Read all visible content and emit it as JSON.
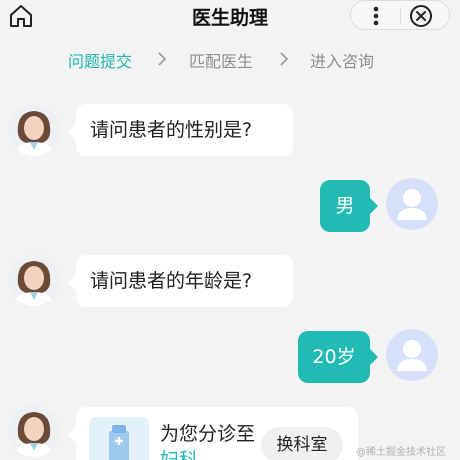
{
  "header": {
    "title": "医生助理",
    "icons": {
      "home": "home-icon",
      "more": "more-icon",
      "close": "close-icon"
    }
  },
  "steps": [
    {
      "label": "问题提交",
      "active": true
    },
    {
      "label": "匹配医生",
      "active": false
    },
    {
      "label": "进入咨询",
      "active": false
    }
  ],
  "messages": [
    {
      "from": "doctor",
      "text": "请问患者的性别是?"
    },
    {
      "from": "user",
      "text": "男"
    },
    {
      "from": "doctor",
      "text": "请问患者的年龄是?"
    },
    {
      "from": "user",
      "text": "20岁"
    }
  ],
  "triage_card": {
    "text": "为您分诊至",
    "department": "妇科",
    "switch_label": "换科室"
  },
  "watermark": "@稀土掘金技术社区",
  "colors": {
    "accent": "#22bbb4",
    "background": "#f3f3f3",
    "bubble": "#ffffff"
  }
}
